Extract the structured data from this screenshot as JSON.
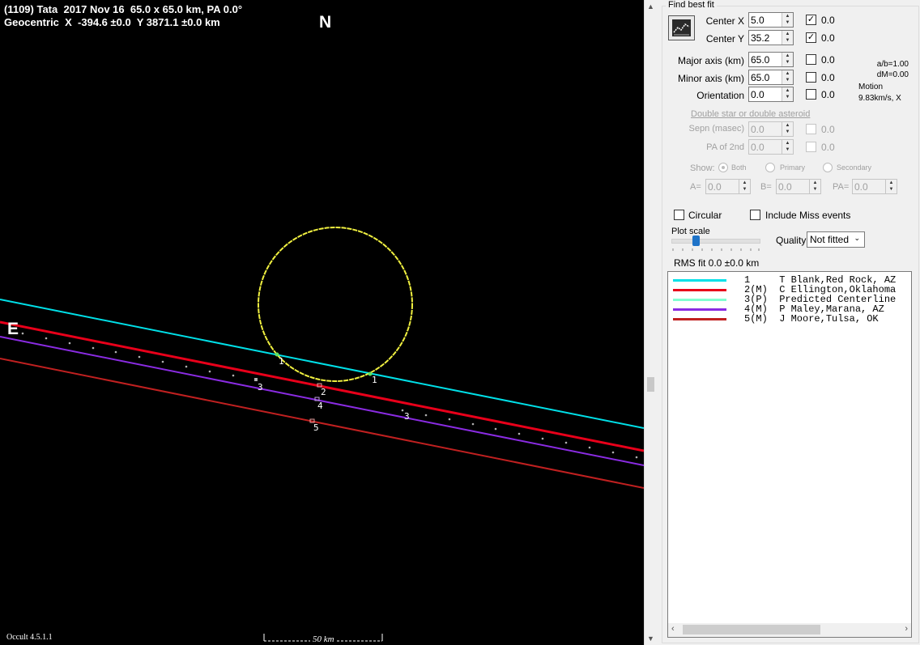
{
  "header": {
    "line1": "(1109) Tata  2017 Nov 16  65.0 x 65.0 km, PA 0.0°",
    "line2": "Geocentric  X  -394.6 ±0.0  Y 3871.1 ±0.0 km"
  },
  "compass": {
    "north": "N",
    "east": "E"
  },
  "scale": {
    "label": "50 km"
  },
  "version": "Occult 4.5.1.1",
  "chord_labels": [
    "1",
    "1",
    "2",
    "3",
    "3",
    "4",
    "5"
  ],
  "colors": {
    "chord1": "#00e0e8",
    "chord2": "#e8001a",
    "chord3": "#80ffd0",
    "chord4": "#8a2be2",
    "chord5": "#c02020",
    "ellipse": "#f0f040",
    "plot_bg": "#000000"
  },
  "panel": {
    "group_title": "Find best fit",
    "fit_button_icon": "chart-fit-icon",
    "center_x": {
      "label": "Center X",
      "value": "5.0",
      "checked": true,
      "unc": "0.0"
    },
    "center_y": {
      "label": "Center Y",
      "value": "35.2",
      "checked": true,
      "unc": "0.0"
    },
    "major": {
      "label": "Major axis (km)",
      "value": "65.0",
      "checked": false,
      "unc": "0.0"
    },
    "minor": {
      "label": "Minor axis (km)",
      "value": "65.0",
      "checked": false,
      "unc": "0.0"
    },
    "orient": {
      "label": "Orientation",
      "value": "0.0",
      "checked": false,
      "unc": "0.0"
    },
    "ab_ratio": "a/b=1.00",
    "dm": "dM=0.00",
    "motion_label": "Motion",
    "motion_value": "9.83km/s, X",
    "double_link": "Double star  or  double asteroid",
    "sepn": {
      "label": "Sepn (masec)",
      "value": "0.0",
      "unc": "0.0"
    },
    "pa2": {
      "label": "PA of 2nd",
      "value": "0.0",
      "unc": "0.0"
    },
    "show_label": "Show:",
    "show_opts": [
      "Both",
      "Primary",
      "Secondary"
    ],
    "a_label": "A=",
    "a_value": "0.0",
    "b_label": "B=",
    "b_value": "0.0",
    "pa_label": "PA=",
    "pa_value": "0.0",
    "circular": "Circular",
    "include_miss": "Include Miss events",
    "plot_scale": "Plot scale",
    "quality_label": "Quality",
    "quality_value": "Not fitted",
    "rms": "RMS fit 0.0 ±0.0 km"
  },
  "legend": [
    {
      "text": "1     T Blank,Red Rock, AZ",
      "color": "#00e0e8"
    },
    {
      "text": "2(M)  C Ellington,Oklahoma",
      "color": "#e8001a"
    },
    {
      "text": "3(P)  Predicted Centerline",
      "color": "#80ffd0"
    },
    {
      "text": "4(M)  P Maley,Marana, AZ",
      "color": "#8a2be2"
    },
    {
      "text": "5(M)  J Moore,Tulsa, OK",
      "color": "#c02020"
    }
  ]
}
